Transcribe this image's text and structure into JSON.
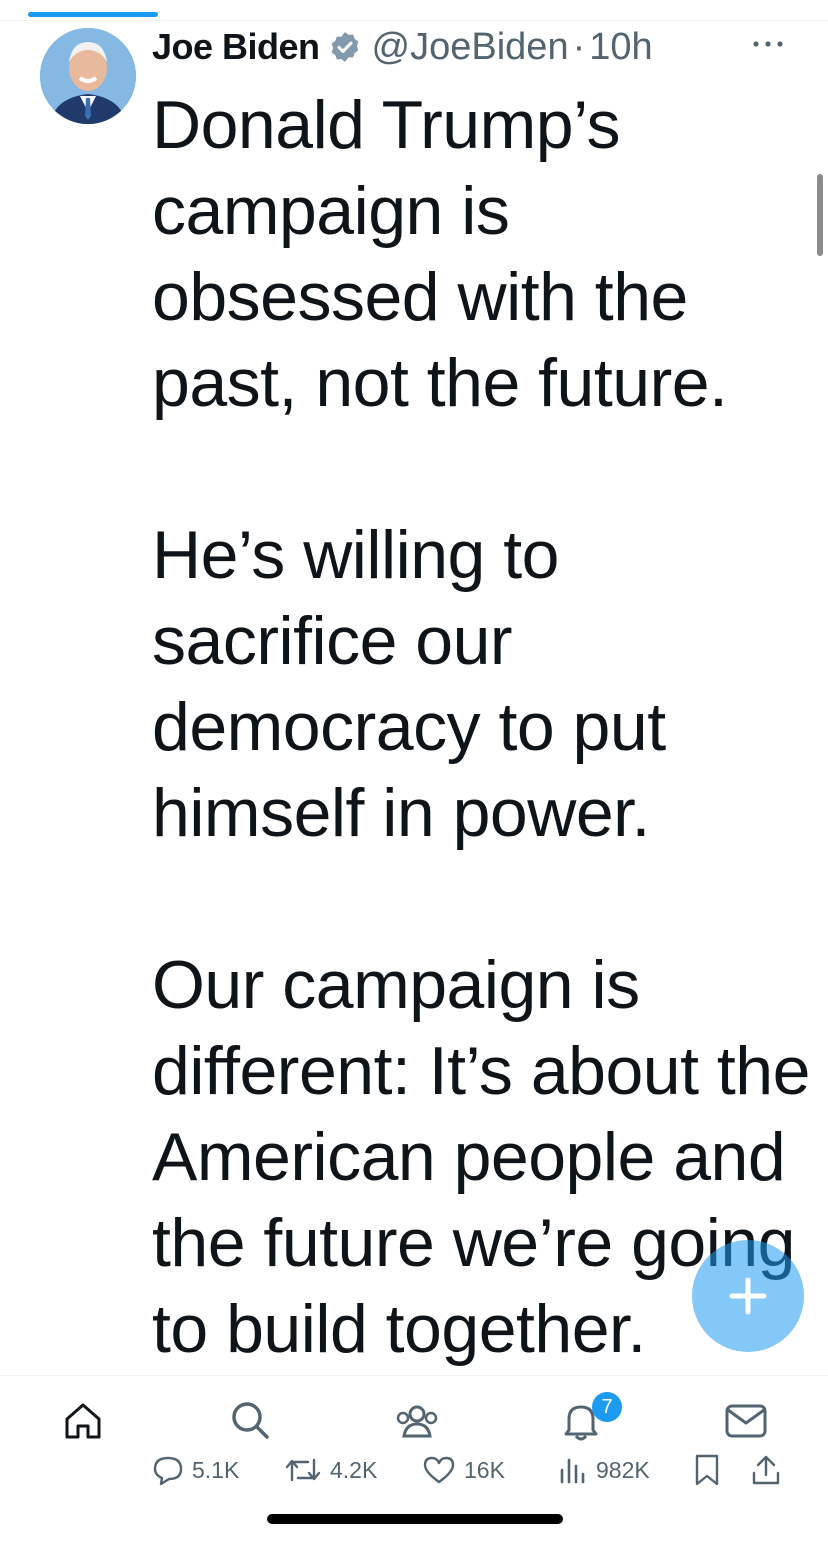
{
  "tweet": {
    "author_name": "Joe Biden",
    "handle": "@JoeBiden",
    "separator": "·",
    "time": "10h",
    "paragraphs": [
      "Donald Trump’s campaign is obsessed with the past, not the future.",
      "He’s willing to sacrifice our democracy to put himself in power.",
      "Our campaign is different: It’s about the American people and the future we’re going to build together."
    ]
  },
  "actions": {
    "replies": "5.1K",
    "reposts": "4.2K",
    "likes": "16K",
    "views": "982K"
  },
  "nav": {
    "notification_badge": "7"
  },
  "colors": {
    "accent": "#1d9bf0",
    "text": "#0f1419",
    "muted": "#536471"
  },
  "icons": [
    "avatar",
    "verified-icon",
    "more-icon",
    "compose-icon",
    "home-icon",
    "search-icon",
    "communities-icon",
    "notifications-icon",
    "messages-icon",
    "reply-icon",
    "repost-icon",
    "like-icon",
    "views-icon",
    "bookmark-icon",
    "share-icon"
  ]
}
